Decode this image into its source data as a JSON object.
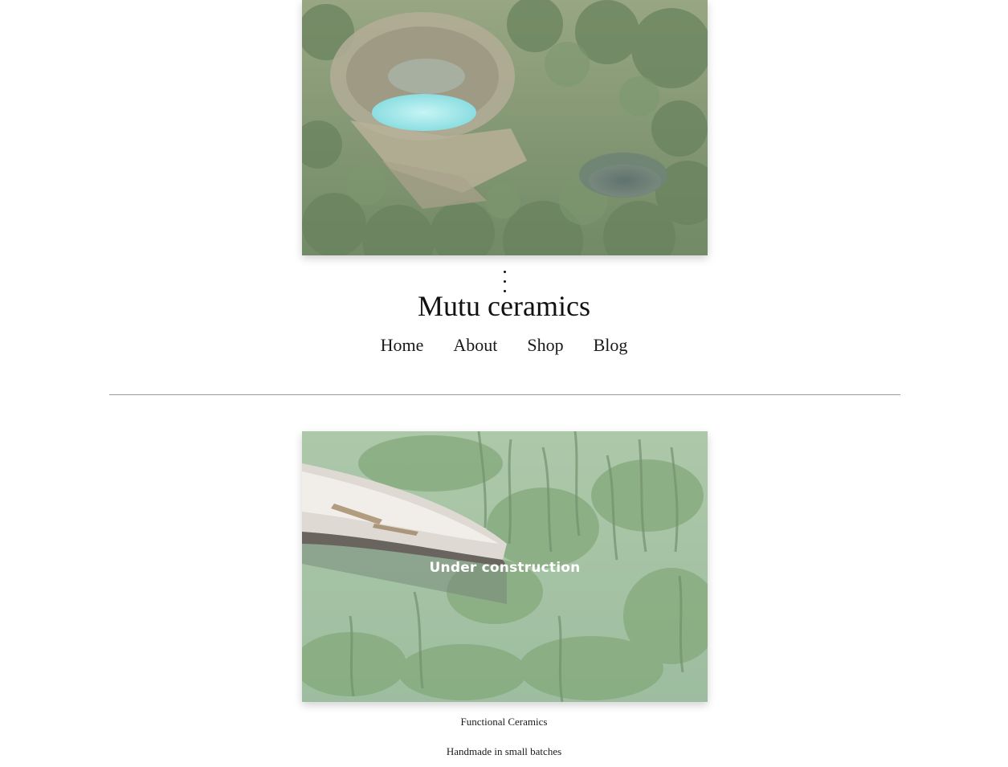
{
  "site": {
    "title": "Mutu ceramics"
  },
  "nav": {
    "items": [
      {
        "label": "Home"
      },
      {
        "label": "About"
      },
      {
        "label": "Shop"
      },
      {
        "label": "Blog"
      }
    ]
  },
  "feature": {
    "overlay_text": "Under construction"
  },
  "captions": {
    "line1": "Functional Ceramics",
    "line2": "Handmade in small batches"
  },
  "colors": {
    "text": "#1a1a1a",
    "divider": "#9a9a9a",
    "overlay_text": "#ffffff"
  }
}
